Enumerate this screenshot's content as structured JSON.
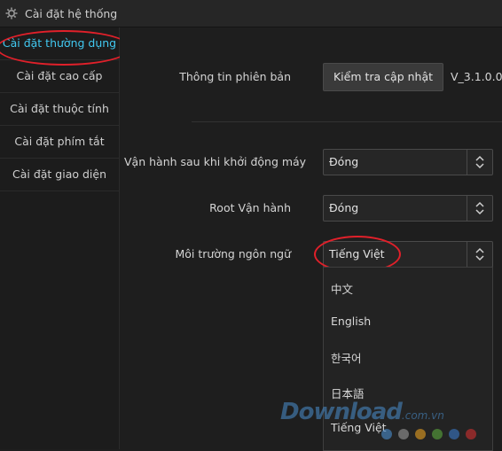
{
  "window": {
    "title": "Cài đặt hệ thống"
  },
  "sidebar": {
    "items": [
      {
        "label": "Cài đặt thường dụng"
      },
      {
        "label": "Cài đặt cao cấp"
      },
      {
        "label": "Cài đặt thuộc tính"
      },
      {
        "label": "Cài đặt phím tắt"
      },
      {
        "label": "Cài đặt giao diện"
      }
    ]
  },
  "version_row": {
    "label": "Thông tin phiên bản",
    "check_button": "Kiểm tra cập nhật",
    "version": "V_3.1.0.0"
  },
  "startup_row": {
    "label": "Vận hành sau khi khởi động máy",
    "value": "Đóng"
  },
  "root_row": {
    "label": "Root Vận hành",
    "value": "Đóng"
  },
  "language_row": {
    "label": "Môi trường ngôn ngữ",
    "value": "Tiếng Việt",
    "options": [
      "中文",
      "English",
      "한국어",
      "日本語",
      "Tiếng Việt"
    ]
  },
  "watermark": {
    "main": "Download",
    "suffix": ".com.vn"
  },
  "colors": {
    "accent": "#41c8f0",
    "highlight_ring": "#e0202a",
    "watermark_dots": [
      "#4a8fcf",
      "#9a9a9a",
      "#e8a020",
      "#5aa83c",
      "#3a78c8",
      "#d03030"
    ]
  },
  "icons": {
    "title": "gear-icon",
    "select_arrow": "updown-chevron-icon"
  }
}
